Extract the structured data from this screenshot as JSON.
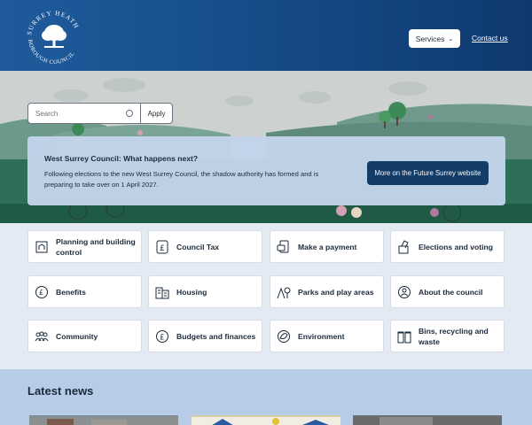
{
  "header": {
    "logo_alt": "Surrey Heath Borough Council",
    "services_label": "Services",
    "contact_label": "Contact us"
  },
  "search": {
    "placeholder": "Search",
    "apply_label": "Apply"
  },
  "notice": {
    "title": "West Surrey Council: What happens next?",
    "body": "Following elections to the new West Surrey Council, the shadow authority has formed and is preparing to take over on 1 April 2027.",
    "button_label": "More on the Future Surrey website"
  },
  "services": [
    {
      "label": "Planning and building control",
      "icon": "house-icon"
    },
    {
      "label": "Council Tax",
      "icon": "pound-icon"
    },
    {
      "label": "Make a payment",
      "icon": "payment-icon"
    },
    {
      "label": "Elections and voting",
      "icon": "ballot-icon"
    },
    {
      "label": "Benefits",
      "icon": "benefits-icon"
    },
    {
      "label": "Housing",
      "icon": "buildings-icon"
    },
    {
      "label": "Parks and play areas",
      "icon": "playground-icon"
    },
    {
      "label": "About the council",
      "icon": "council-icon"
    },
    {
      "label": "Community",
      "icon": "people-icon"
    },
    {
      "label": "Budgets and finances",
      "icon": "pound-coin-icon"
    },
    {
      "label": "Environment",
      "icon": "leaf-icon"
    },
    {
      "label": "Bins, recycling and waste",
      "icon": "bin-icon"
    }
  ],
  "news": {
    "title": "Latest news"
  },
  "colors": {
    "header": "#174d8a",
    "notice_bg": "#c3d4ea",
    "notice_button": "#123a68",
    "news_bg": "#b7cde7"
  }
}
